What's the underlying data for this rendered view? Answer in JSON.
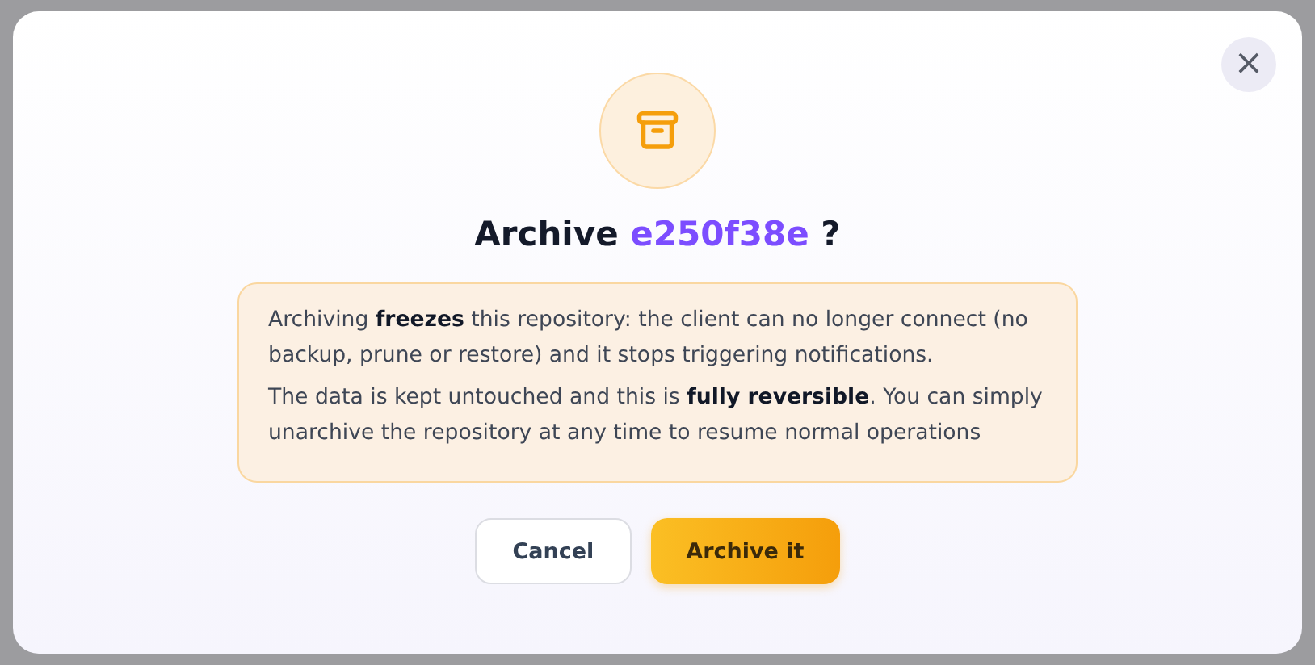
{
  "dialog": {
    "close_button": "×",
    "title": {
      "prefix": "Archive",
      "repo_id": "e250f38e",
      "suffix": "?"
    },
    "notice": [
      "Archiving **freezes** this repository: the client can no longer connect (no backup, prune or restore) and it stops triggering notifications.",
      "The data is kept untouched and this is **fully reversible**. You can simply unarchive the repository at any time to resume normal operations"
    ],
    "buttons": [
      {
        "label": "Cancel",
        "kind": "secondary"
      },
      {
        "label": "Archive it",
        "kind": "primary"
      }
    ]
  }
}
